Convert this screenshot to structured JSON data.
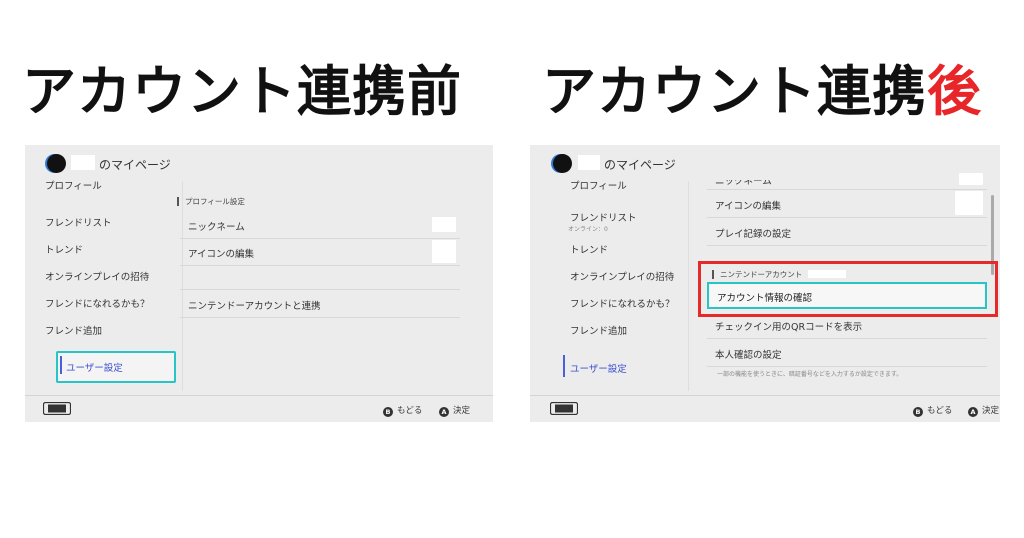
{
  "headings": {
    "before": "アカウント連携前",
    "after_main": "アカウント連携",
    "after_accent": "後",
    "accent_color": "#e8262a"
  },
  "common": {
    "mypage": "のマイページ",
    "sidebar": {
      "profile": "プロフィール",
      "friend_list": "フレンドリスト",
      "trend": "トレンド",
      "invite": "オンラインプレイの招待",
      "maybe_friends": "フレンドになれるかも？",
      "add_friend": "フレンド追加",
      "user_settings": "ユーザー設定"
    },
    "footer": {
      "back": "もどる",
      "confirm": "決定",
      "b_key": "B",
      "a_key": "A"
    }
  },
  "before": {
    "section": "プロフィール設定",
    "rows": {
      "nickname": "ニックネーム",
      "icon_edit": "アイコンの編集",
      "link": "ニンテンドーアカウントと連携"
    }
  },
  "after": {
    "online_count": "オンライン：0",
    "rows_top": {
      "nickname_cut": "ニックネーム",
      "icon_edit": "アイコンの編集",
      "play_record": "プレイ記録の設定"
    },
    "section": "ニンテンドーアカウント",
    "rows": {
      "account_info": "アカウント情報の確認",
      "qr": "チェックイン用のQRコードを表示",
      "identity": "本人確認の設定"
    },
    "note": "一部の機能を使うときに、暗証番号などを入力するか設定できます。"
  },
  "colors": {
    "focus": "#27c5c5",
    "highlight_frame": "#e52a2a",
    "selected_text": "#3c4fd0"
  }
}
